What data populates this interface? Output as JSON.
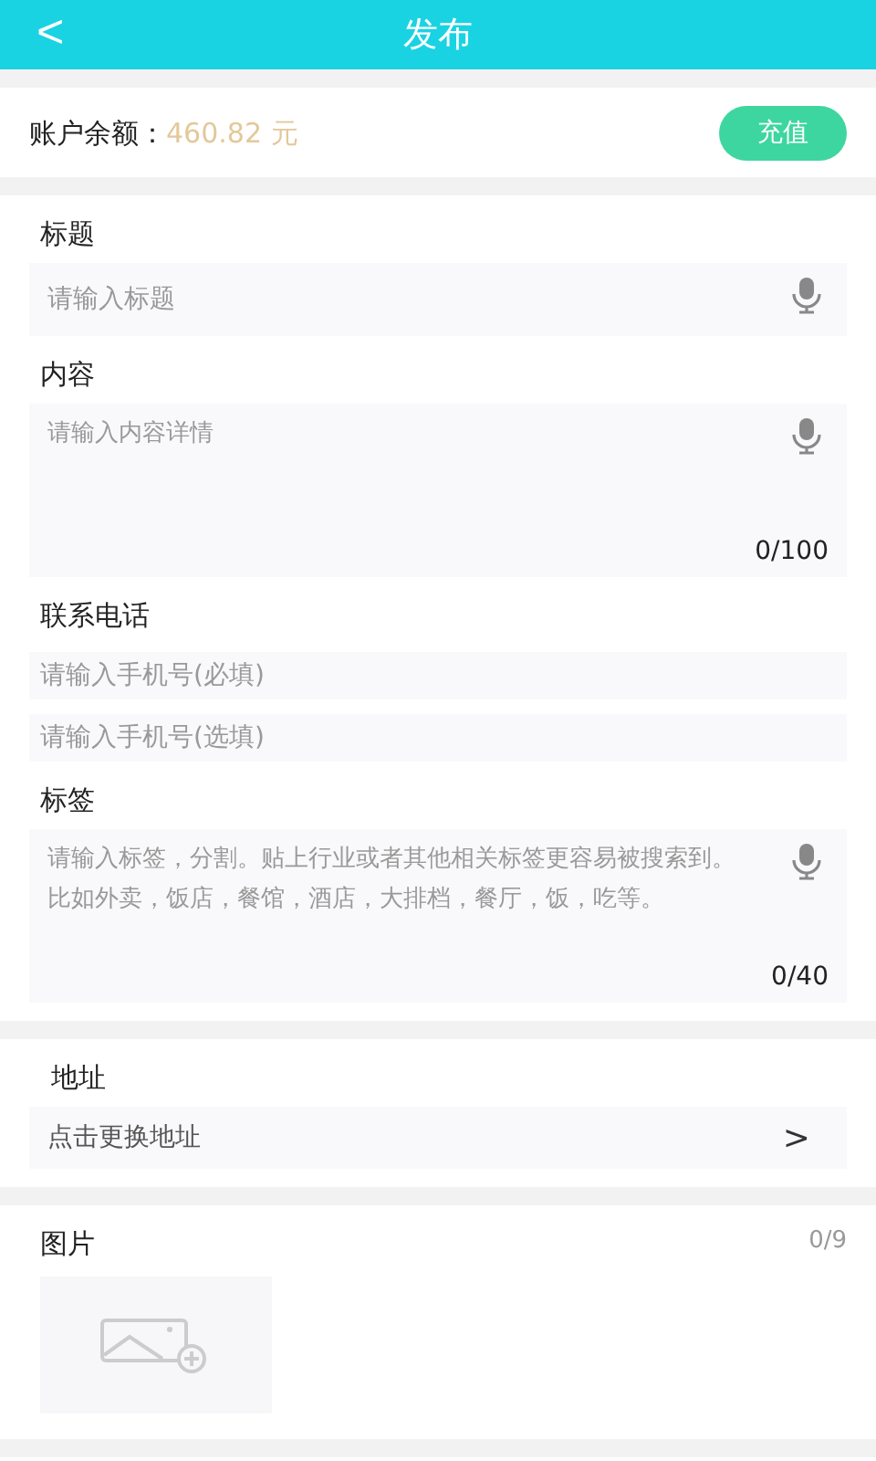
{
  "header": {
    "back": "<",
    "title": "发布"
  },
  "balance": {
    "label": "账户余额：",
    "amount": "460.82 元",
    "button": "充值"
  },
  "form": [
    {
      "kind": "single",
      "label": "标题",
      "placeholder": "请输入标题"
    },
    {
      "kind": "area",
      "label": "内容",
      "placeholder": "请输入内容详情",
      "counter": "0/100"
    },
    {
      "kind": "phones",
      "label": "联系电话",
      "placeholders": [
        "请输入手机号(必填)",
        "请输入手机号(选填)"
      ]
    },
    {
      "kind": "area",
      "label": "标签",
      "placeholder": "请输入标签，分割。贴上行业或者其他相关标签更容易被搜索到。比如外卖，饭店，餐馆，酒店，大排档，餐厅，饭，吃等。",
      "counter": "0/40"
    }
  ],
  "address": {
    "label": "地址",
    "action": "点击更换地址",
    "chevron": ">"
  },
  "pictures": {
    "label": "图片",
    "counter": "0/9"
  }
}
